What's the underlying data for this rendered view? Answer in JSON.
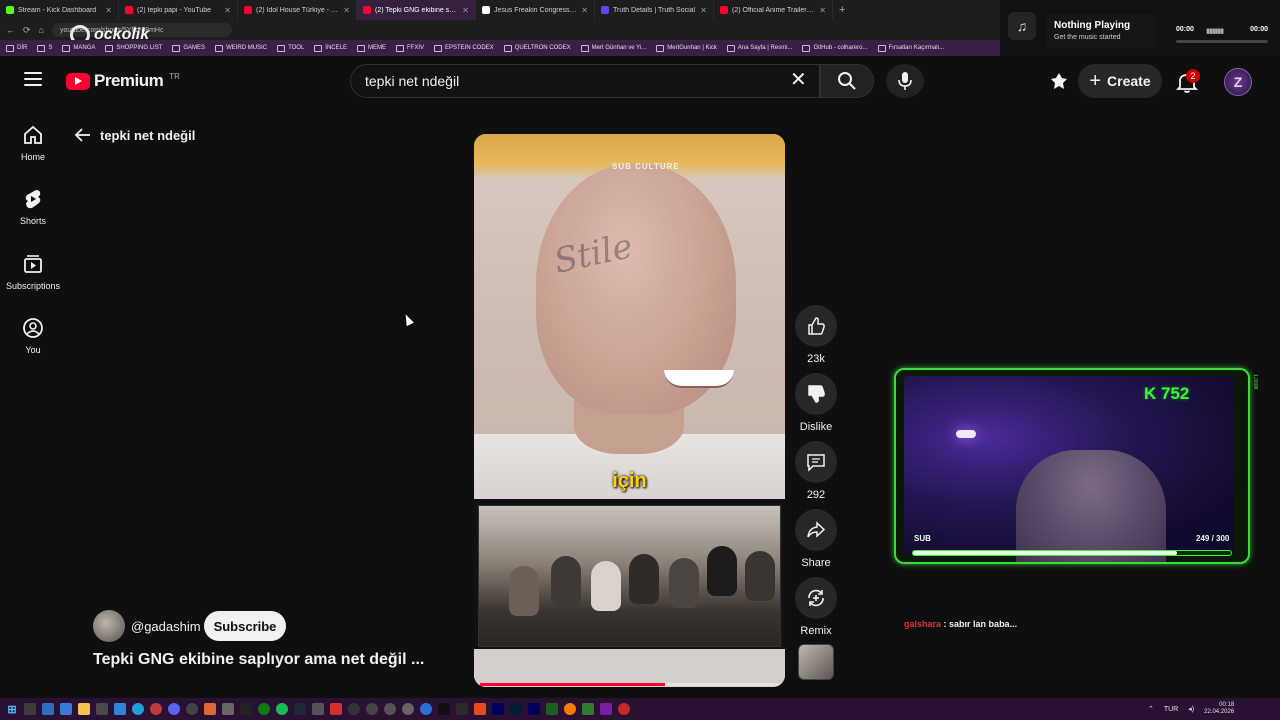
{
  "tabs": [
    {
      "label": "Stream - Kick Dashboard",
      "color": "#53fc18",
      "active": false
    },
    {
      "label": "(2) tepki papi - YouTube",
      "color": "#ff0033",
      "active": false
    },
    {
      "label": "(2) Idol House Türkiye - YouTube",
      "color": "#ff0033",
      "active": false
    },
    {
      "label": "(2) Tepki GNG ekibine saplıyo",
      "color": "#ff0033",
      "active": true
    },
    {
      "label": "Jesus Freakin Congress on Xi \"You",
      "color": "#ffffff",
      "active": false
    },
    {
      "label": "Truth Details | Truth Social",
      "color": "#5448ee",
      "active": false
    },
    {
      "label": "(2) Official Anime Trailer | Rooster",
      "color": "#ff0033",
      "active": false
    }
  ],
  "browser": {
    "new_tab": "+",
    "url": "youtube.com/shorts/5Yflb-88mHc",
    "overlay_brand": "ockolik",
    "nav_back": "←",
    "nav_reload": "⟳",
    "nav_home": "⌂",
    "win_controls": [
      "—",
      "▢",
      "✕"
    ]
  },
  "bookmarks": [
    "DİR",
    "S",
    "MANGA",
    "SHOPPING LIST",
    "GAMES",
    "WEIRD MUSIC",
    "TOOL",
    "İNCELE",
    "MEME",
    "FFXIV",
    "EPSTEIN CODEX",
    "QUELTRON CODEX",
    "Mert Günhan ve Yi...",
    "MertGunhan | Kick",
    "Ana Sayfa | Resmi...",
    "GitHub - colharero...",
    "Fırsatları Kaçırmalı..."
  ],
  "now_playing": {
    "title": "Nothing Playing",
    "subtitle": "Get the music started",
    "time_start": "00:00",
    "time_end": "00:00",
    "icon": "music-note-icon"
  },
  "header": {
    "logo_text": "Premium",
    "logo_region": "TR",
    "search_value": "tepki net ndeğil",
    "create_label": "Create",
    "notif_count": "2"
  },
  "sidebar": {
    "items": [
      {
        "label": "Home",
        "icon": "home-icon"
      },
      {
        "label": "Shorts",
        "icon": "shorts-icon"
      },
      {
        "label": "Subscriptions",
        "icon": "subscriptions-icon"
      },
      {
        "label": "You",
        "icon": "you-icon"
      }
    ]
  },
  "page": {
    "back_title": "tepki net ndeğil"
  },
  "video": {
    "watermark": "SUB CULTURE",
    "caption": "için",
    "progress": 0.62,
    "title": "Tepki GNG ekibine saplıyor ama net değil ...",
    "channel": "@gadashim",
    "subscribe": "Subscribe"
  },
  "actions": [
    {
      "label": "23k",
      "icon": "like-icon"
    },
    {
      "label": "Dislike",
      "icon": "dislike-icon"
    },
    {
      "label": "292",
      "icon": "comments-icon"
    },
    {
      "label": "Share",
      "icon": "share-icon"
    },
    {
      "label": "Remix",
      "icon": "remix-icon"
    }
  ],
  "stream_overlay": {
    "kick_count": "K 752",
    "sub_label": "SUB",
    "sub_progress": "249 / 300",
    "sub_fraction": 0.83,
    "side_label": "1,000K",
    "chat_user": "galshara",
    "chat_message": ": sabır lan baba..."
  },
  "taskbar": {
    "lang": "TUR",
    "time": "00:18",
    "date": "22.04.2026"
  }
}
